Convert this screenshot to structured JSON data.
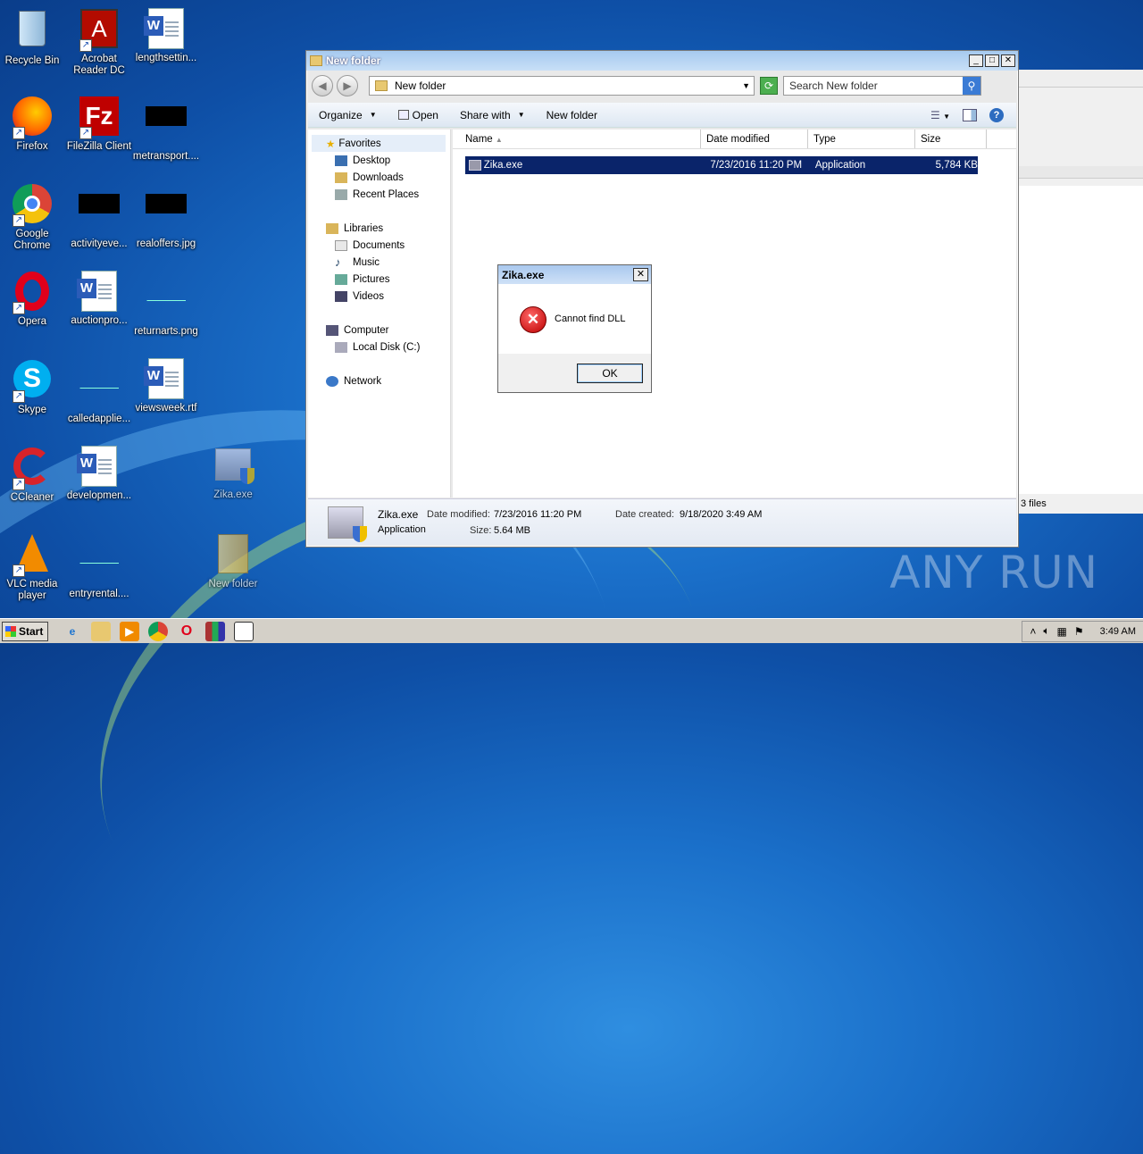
{
  "desktop": {
    "icons": [
      {
        "label": "Recycle Bin",
        "icon": "recycle-bin-icon"
      },
      {
        "label": "Acrobat Reader DC",
        "icon": "acrobat-icon"
      },
      {
        "label": "lengthsettin...",
        "icon": "word-doc-icon"
      },
      {
        "label": "Firefox",
        "icon": "firefox-icon"
      },
      {
        "label": "FileZilla Client",
        "icon": "filezilla-icon"
      },
      {
        "label": "metransport....",
        "icon": "image-thumb-icon"
      },
      {
        "label": "Google Chrome",
        "icon": "chrome-icon"
      },
      {
        "label": "activityeve...",
        "icon": "image-thumb-icon"
      },
      {
        "label": "realoffers.jpg",
        "icon": "image-thumb-icon"
      },
      {
        "label": "Opera",
        "icon": "opera-icon"
      },
      {
        "label": "auctionpro...",
        "icon": "word-doc-icon"
      },
      {
        "label": "returnarts.png",
        "icon": "image-thumb-icon"
      },
      {
        "label": "Skype",
        "icon": "skype-icon"
      },
      {
        "label": "calledapplie...",
        "icon": "file-icon"
      },
      {
        "label": "viewsweek.rtf",
        "icon": "word-doc-icon"
      },
      {
        "label": "CCleaner",
        "icon": "ccleaner-icon"
      },
      {
        "label": "developmen...",
        "icon": "word-doc-icon"
      },
      {
        "label": "Zika.exe",
        "icon": "exe-icon"
      },
      {
        "label": "VLC media player",
        "icon": "vlc-icon"
      },
      {
        "label": "entryrental....",
        "icon": "file-icon"
      },
      {
        "label": "New folder",
        "icon": "folder-icon"
      }
    ]
  },
  "explorer": {
    "title": "New folder",
    "address": "New folder",
    "search_placeholder": "Search New folder",
    "toolbar": {
      "organize": "Organize",
      "open": "Open",
      "share_with": "Share with",
      "new_folder": "New folder"
    },
    "nav": {
      "favorites": "Favorites",
      "desktop": "Desktop",
      "downloads": "Downloads",
      "recent": "Recent Places",
      "libraries": "Libraries",
      "documents": "Documents",
      "music": "Music",
      "pictures": "Pictures",
      "videos": "Videos",
      "computer": "Computer",
      "local_disk": "Local Disk (C:)",
      "network": "Network"
    },
    "columns": {
      "name": "Name",
      "date": "Date modified",
      "type": "Type",
      "size": "Size"
    },
    "files": [
      {
        "name": "Zika.exe",
        "date": "7/23/2016 11:20 PM",
        "type": "Application",
        "size": "5,784 KB"
      }
    ],
    "details": {
      "name": "Zika.exe",
      "type": "Application",
      "date_modified_label": "Date modified:",
      "date_modified": "7/23/2016 11:20 PM",
      "size_label": "Size:",
      "size": "5.64 MB",
      "date_created_label": "Date created:",
      "date_created": "9/18/2020 3:49 AM"
    }
  },
  "dialog": {
    "title": "Zika.exe",
    "message": "Cannot find DLL",
    "ok": "OK"
  },
  "background_window": {
    "status": "3 files"
  },
  "taskbar": {
    "start": "Start",
    "clock": "3:49 AM"
  },
  "watermark": "ANY RUN"
}
